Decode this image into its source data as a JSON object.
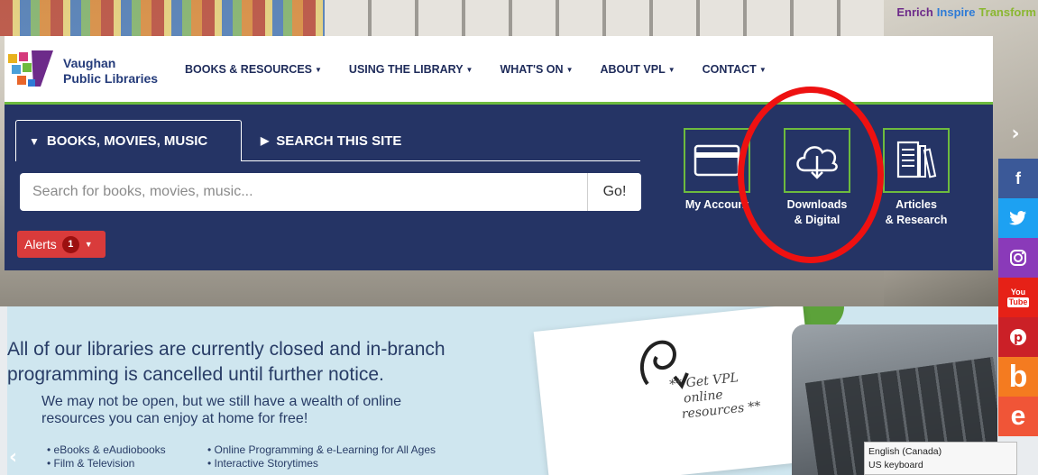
{
  "tagline": {
    "enrich": "Enrich",
    "inspire": "Inspire",
    "transform": "Transform",
    "colors": {
      "enrich": "#6d2b8a",
      "inspire": "#2e7bd6",
      "transform": "#8ab731"
    }
  },
  "logo": {
    "line1": "Vaughan",
    "line2": "Public Libraries"
  },
  "nav": {
    "items": [
      {
        "label": "BOOKS & RESOURCES"
      },
      {
        "label": "USING THE LIBRARY"
      },
      {
        "label": "WHAT'S ON"
      },
      {
        "label": "ABOUT VPL"
      },
      {
        "label": "CONTACT"
      }
    ]
  },
  "search": {
    "tab_active": "BOOKS, MOVIES, MUSIC",
    "tab_inactive": "SEARCH THIS SITE",
    "placeholder": "Search for books, movies, music...",
    "go_label": "Go!"
  },
  "alerts": {
    "label": "Alerts",
    "count": "1"
  },
  "quick_access": [
    {
      "label_line1": "My Account",
      "label_line2": "",
      "icon": "credit-card-icon"
    },
    {
      "label_line1": "Downloads",
      "label_line2": "& Digital",
      "icon": "cloud-download-icon"
    },
    {
      "label_line1": "Articles",
      "label_line2": "& Research",
      "icon": "articles-icon"
    }
  ],
  "social": [
    {
      "icon": "facebook-icon",
      "glyph": "f",
      "color": "#3b5998"
    },
    {
      "icon": "twitter-icon",
      "glyph": "🐦",
      "color": "#1da1f2"
    },
    {
      "icon": "instagram-icon",
      "glyph": "◎",
      "color": "#8a3ab9"
    },
    {
      "icon": "youtube-icon",
      "glyph": "You Tube",
      "color": "#e62117"
    },
    {
      "icon": "pinterest-icon",
      "glyph": "℗",
      "color": "#cb2027"
    },
    {
      "icon": "bibliocommons-icon",
      "glyph": "b",
      "color": "#f47b20"
    },
    {
      "icon": "eventbrite-icon",
      "glyph": "e",
      "color": "#f05537"
    }
  ],
  "banner": {
    "headline_line1": "All of our libraries are currently closed and in-branch",
    "headline_line2": "programming is cancelled until further notice.",
    "sub_line1": "We may not be open, but we still have a wealth of online",
    "sub_line2": "resources you can enjoy at home for free!",
    "list_col1": [
      "• eBooks  & eAudiobooks",
      "• Film & Television"
    ],
    "list_col2": [
      "• Online Programming & e-Learning for All Ages",
      "• Interactive Storytimes"
    ],
    "note_line1": "** Get VPL",
    "note_line2": "online",
    "note_line3": "resources **"
  },
  "keyboard_popup": {
    "line1": "English (Canada)",
    "line2": "US keyboard"
  }
}
